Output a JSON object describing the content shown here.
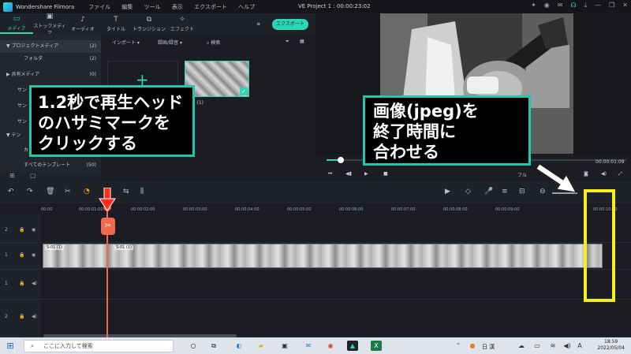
{
  "titlebar": {
    "app_name": "Wondershare Filmora",
    "menu": [
      "ファイル",
      "編集",
      "ツール",
      "表示",
      "エクスポート",
      "ヘルプ"
    ],
    "project_title": "VE Project 1 : 00:00:23:02"
  },
  "media_toolbar": {
    "tabs": [
      "メディア",
      "ストックメディア",
      "オーディオ",
      "タイトル",
      "トランジション",
      "エフェクト"
    ],
    "export_label": "エクスポート"
  },
  "sidebar": {
    "items": [
      {
        "label": "▼ プロジェクトメディア",
        "count": "(2)"
      },
      {
        "label": "フォルダ",
        "count": "(2)"
      },
      {
        "label": "▶ 共有メディア",
        "count": "(0)"
      },
      {
        "label": "サン",
        "count": ""
      },
      {
        "label": "サン",
        "count": ""
      },
      {
        "label": "サン",
        "count": ""
      },
      {
        "label": "▼ テン",
        "count": ""
      },
      {
        "label": "カ",
        "count": ""
      },
      {
        "label": "すべてのテンプレート",
        "count": "(50)"
      }
    ]
  },
  "media": {
    "import_label": "インポート",
    "record_label": "録画/録音",
    "search_placeholder": "検索",
    "thumb_label": "S-01 (1)"
  },
  "preview": {
    "timecode": "00:00:01:09",
    "quality": "フル"
  },
  "ruler": {
    "ticks": [
      "00:00",
      "00:00:01:00",
      "00:00:02:00",
      "00:00:03:00",
      "00:00:04:00",
      "00:00:05:00",
      "00:00:06:00",
      "00:00:07:00",
      "00:00:08:00",
      "00:00:09:00",
      "00:00:10:00"
    ]
  },
  "tracks": {
    "labels": [
      "2",
      "1",
      "1",
      "2"
    ],
    "clip_label_1": "S-01 (1)",
    "clip_label_2": "S-01 (1)"
  },
  "callouts": {
    "left_text": [
      "1.2秒で再生ヘッド",
      "のハサミマークを",
      "クリックする"
    ],
    "right_text": [
      "画像(jpeg)を",
      "終了時間に",
      "合わせる"
    ]
  },
  "taskbar": {
    "search_placeholder": "ここに入力して検索",
    "lang": "日 漢",
    "time": "18:59",
    "date": "2022/05/04"
  },
  "colors": {
    "accent": "#2fd6b4",
    "playhead": "#f2694f",
    "callout_border": "#25c4ae",
    "highlight": "#f4ef1a"
  }
}
